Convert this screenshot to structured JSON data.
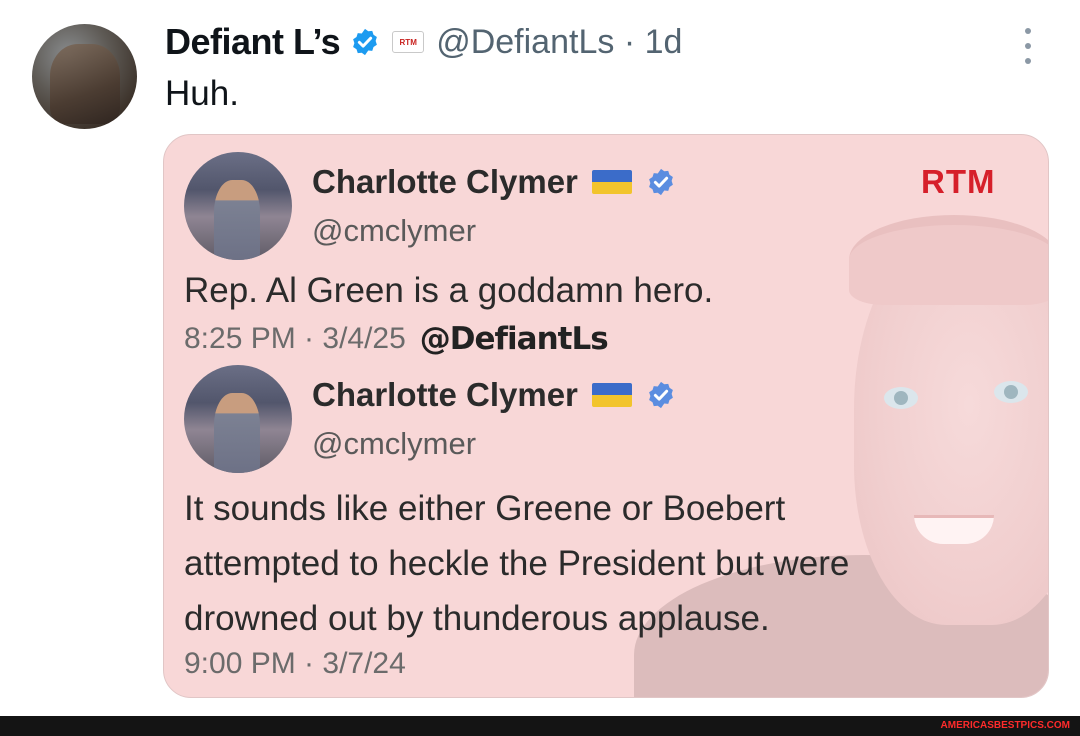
{
  "post": {
    "author_name": "Defiant L’s",
    "handle": "@DefiantLs",
    "separator": "·",
    "time": "1d",
    "text": "Huh.",
    "badge_label": "RTM"
  },
  "media": {
    "logo": "RTM",
    "quotes": [
      {
        "name": "Charlotte Clymer",
        "handle": "@cmclymer",
        "text": "Rep. Al Green is a goddamn hero.",
        "timestamp": "8:25 PM · 3/4/25",
        "watermark": "@DefiantLs"
      },
      {
        "name": "Charlotte Clymer",
        "handle": "@cmclymer",
        "text_lines": [
          "It sounds like either Greene or Boebert",
          "attempted to heckle the President but were",
          "drowned out by thunderous applause."
        ],
        "timestamp": "9:00 PM · 3/7/24"
      }
    ]
  },
  "footer": {
    "site": "AMERICASBESTPICS.COM"
  },
  "colors": {
    "verified": "#1d9bf0",
    "media_bg": "#f8d7d7",
    "rtm_red": "#d61f2a"
  },
  "icons": [
    "verified-badge-icon",
    "more-options-icon",
    "ukraine-flag-icon"
  ]
}
